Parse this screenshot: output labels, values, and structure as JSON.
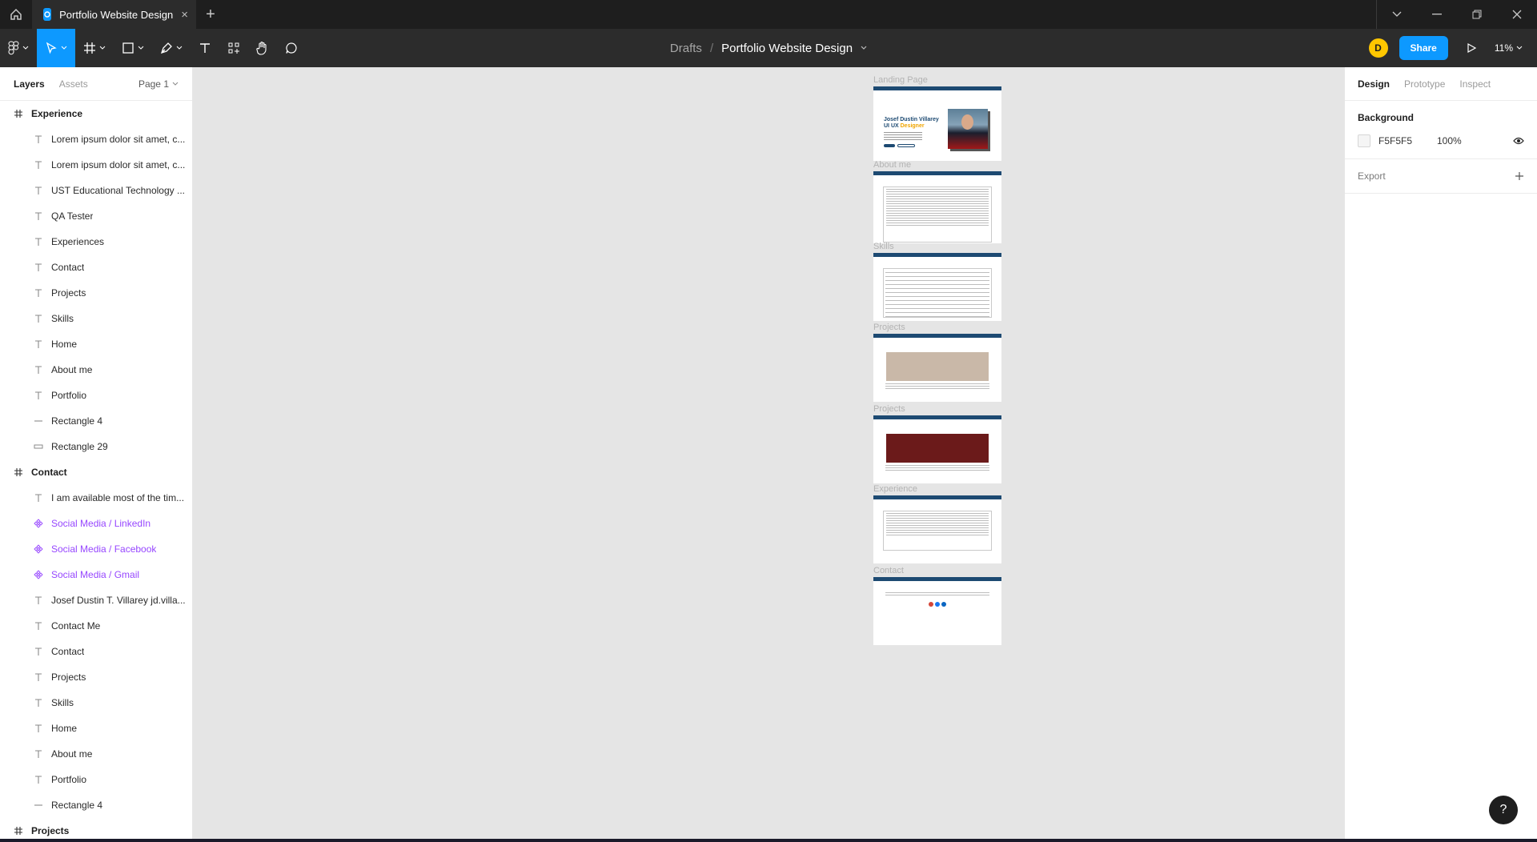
{
  "titlebar": {
    "tab_title": "Portfolio Website Design",
    "tab_close": "×",
    "new_tab": "+"
  },
  "toolbar": {
    "breadcrumb_root": "Drafts",
    "breadcrumb_sep": "/",
    "file_name": "Portfolio Website Design",
    "avatar_initial": "D",
    "share_label": "Share",
    "zoom": "11%",
    "accent": "#0d99ff"
  },
  "left_panel": {
    "tab_layers": "Layers",
    "tab_assets": "Assets",
    "page": "Page 1",
    "layers": [
      {
        "type": "frame",
        "name": "Experience"
      },
      {
        "type": "text",
        "name": "Lorem ipsum dolor sit amet, c..."
      },
      {
        "type": "text",
        "name": "Lorem ipsum dolor sit amet, c..."
      },
      {
        "type": "text",
        "name": "UST Educational Technology ..."
      },
      {
        "type": "text",
        "name": "QA Tester"
      },
      {
        "type": "text",
        "name": "Experiences"
      },
      {
        "type": "text",
        "name": "Contact"
      },
      {
        "type": "text",
        "name": "Projects"
      },
      {
        "type": "text",
        "name": "Skills"
      },
      {
        "type": "text",
        "name": "Home"
      },
      {
        "type": "text",
        "name": "About me"
      },
      {
        "type": "text",
        "name": "Portfolio"
      },
      {
        "type": "line",
        "name": "Rectangle 4"
      },
      {
        "type": "rect",
        "name": "Rectangle 29"
      },
      {
        "type": "frame",
        "name": "Contact"
      },
      {
        "type": "text",
        "name": "I am available most of the tim..."
      },
      {
        "type": "component",
        "name": "Social Media / LinkedIn"
      },
      {
        "type": "component",
        "name": "Social Media / Facebook"
      },
      {
        "type": "component",
        "name": "Social Media / Gmail"
      },
      {
        "type": "text",
        "name": "Josef Dustin T. Villarey jd.villa..."
      },
      {
        "type": "text",
        "name": "Contact Me"
      },
      {
        "type": "text",
        "name": "Contact"
      },
      {
        "type": "text",
        "name": "Projects"
      },
      {
        "type": "text",
        "name": "Skills"
      },
      {
        "type": "text",
        "name": "Home"
      },
      {
        "type": "text",
        "name": "About me"
      },
      {
        "type": "text",
        "name": "Portfolio"
      },
      {
        "type": "line",
        "name": "Rectangle 4"
      },
      {
        "type": "frame",
        "name": "Projects"
      }
    ]
  },
  "canvas": {
    "background": "#e5e5e5",
    "frames": [
      {
        "label": "Landing Page",
        "kind": "landing",
        "hero_name": "Josef Dustin Villarey",
        "hero_role": "UI UX",
        "hero_role_accent": "Designer"
      },
      {
        "label": "About me",
        "kind": "about"
      },
      {
        "label": "Skills",
        "kind": "skills"
      },
      {
        "label": "Projects",
        "kind": "project",
        "image_color": "#c9b8a8"
      },
      {
        "label": "Projects",
        "kind": "project",
        "image_color": "#6b1a1a"
      },
      {
        "label": "Experience",
        "kind": "experience"
      },
      {
        "label": "Contact",
        "kind": "contact"
      }
    ]
  },
  "right_panel": {
    "tab_design": "Design",
    "tab_prototype": "Prototype",
    "tab_inspect": "Inspect",
    "background_heading": "Background",
    "background_hex": "F5F5F5",
    "background_opacity": "100%",
    "export_label": "Export",
    "help": "?"
  }
}
